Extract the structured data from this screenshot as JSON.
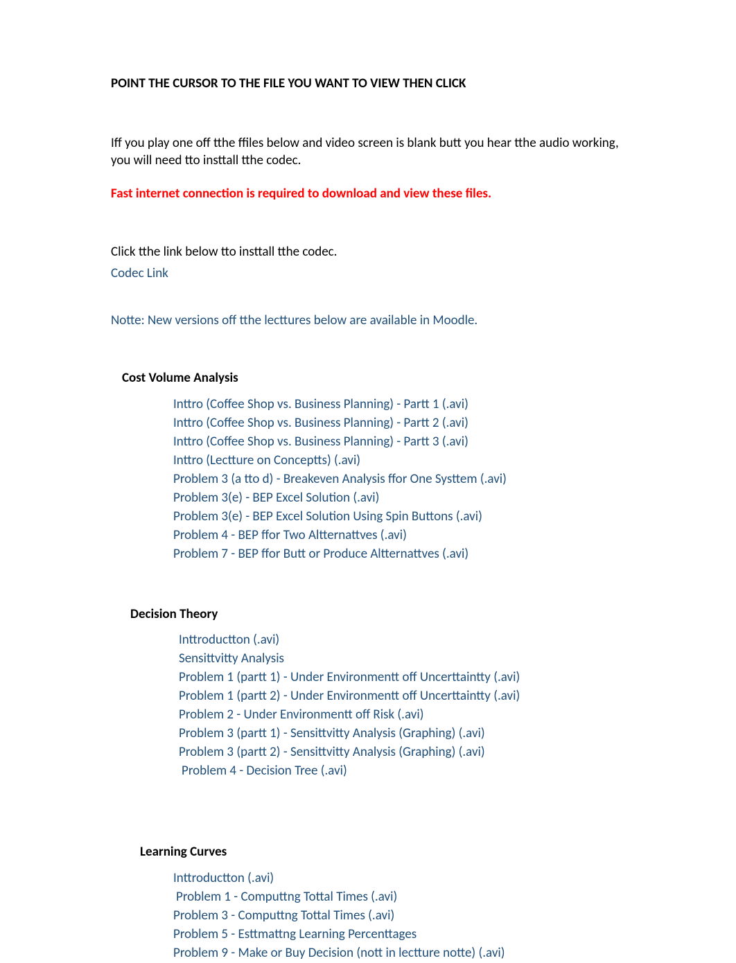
{
  "heading": "POINT THE CURSOR TO THE FILE YOU WANT TO VIEW THEN CLICK",
  "intro": "Iff you play one off tthe ffiles below and video screen is blank butt you hear tthe audio working, you will need tto insttall tthe codec.",
  "warning": "Fast internet connection is required to download and view these files.",
  "install_line": "Click tthe link below tto insttall tthe codec.",
  "codec_link": "Codec Link",
  "note": "Notte: New versions off tthe lecttures below are available in Moodle.",
  "sections": {
    "cva": {
      "title": "Cost Volume Analysis",
      "items": [
        "Inttro (Coffee Shop vs. Business Planning) - Partt 1 (.avi)",
        "Inttro (Coffee Shop vs. Business Planning) - Partt 2 (.avi)",
        "Inttro (Coffee Shop vs. Business Planning) - Partt 3 (.avi)",
        "Inttro (Lectture on Conceptts) (.avi)",
        "Problem 3 (a tto d) - Breakeven Analysis ffor One Systtem (.avi)",
        "Problem 3(e) - BEP Excel Solution (.avi)",
        "Problem 3(e) - BEP Excel Solution Using Spin Buttons (.avi)",
        "Problem 4 - BEP ffor Two Altternattves (.avi)",
        "Problem 7 - BEP ffor Butt or Produce Altternattves (.avi)"
      ]
    },
    "dt": {
      "title": "Decision Theory",
      "items": [
        "Inttroductton (.avi)",
        "Sensittvitty Analysis",
        "Problem 1 (partt 1) - Under Environmentt off Uncerttaintty (.avi)",
        "Problem 1 (partt 2) - Under Environmentt off Uncerttaintty (.avi)",
        "Problem 2 - Under Environmentt off Risk (.avi)",
        "Problem 3 (partt 1) - Sensittvitty Analysis (Graphing) (.avi)",
        "Problem 3 (partt 2) - Sensittvitty Analysis (Graphing) (.avi)",
        "Problem 4 - Decision Tree (.avi)"
      ]
    },
    "lc": {
      "title": "Learning Curves",
      "items": [
        "Inttroductton (.avi)",
        "Problem 1 - Computtng Tottal Times (.avi)",
        "Problem 3 - Computtng Tottal Times (.avi)",
        "Problem 5 - Esttmattng Learning Percenttages",
        "Problem 9 - Make or Buy Decision (nott in lectture notte) (.avi)"
      ]
    }
  }
}
